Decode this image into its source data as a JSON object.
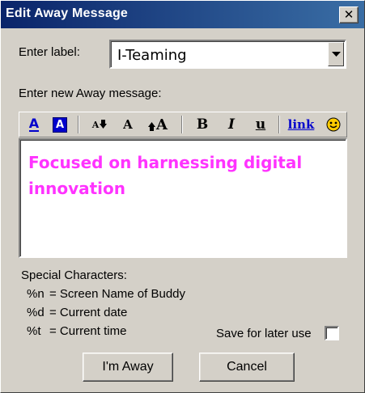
{
  "window": {
    "title": "Edit Away Message",
    "close_glyph": "✕"
  },
  "label_field": {
    "caption": "Enter label:",
    "value": "I-Teaming"
  },
  "message": {
    "caption": "Enter new Away message:",
    "text": "Focused on harnessing digital innovation",
    "text_color": "#ff33ff"
  },
  "toolbar": {
    "items": [
      {
        "name": "text-color-icon",
        "glyph": "A"
      },
      {
        "name": "background-color-icon",
        "glyph": "A"
      },
      {
        "name": "decrease-font-size-icon",
        "glyph": "A"
      },
      {
        "name": "normal-font-size-icon",
        "glyph": "A"
      },
      {
        "name": "increase-font-size-icon",
        "glyph": "A"
      },
      {
        "name": "bold-icon",
        "glyph": "B"
      },
      {
        "name": "italic-icon",
        "glyph": "I"
      },
      {
        "name": "underline-icon",
        "glyph": "u"
      },
      {
        "name": "link-icon",
        "glyph": "link"
      },
      {
        "name": "smiley-icon",
        "glyph": "smiley"
      }
    ],
    "link_label": "link",
    "accent_blue": "#0000cc"
  },
  "special": {
    "heading": "Special Characters:",
    "rows": [
      {
        "code": "%n",
        "desc": "= Screen Name of Buddy"
      },
      {
        "code": "%d",
        "desc": "= Current date"
      },
      {
        "code": "%t",
        "desc": "= Current time"
      }
    ]
  },
  "save_option": {
    "label": "Save for later use",
    "checked": false
  },
  "buttons": {
    "away": "I'm Away",
    "cancel": "Cancel"
  }
}
